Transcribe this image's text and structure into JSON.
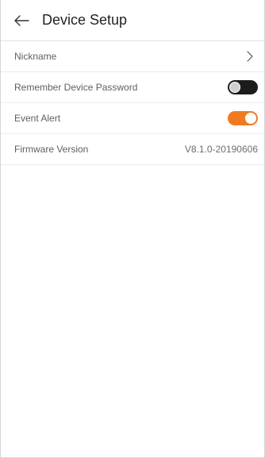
{
  "header": {
    "title": "Device Setup",
    "back_icon": "arrow-left-icon"
  },
  "settings": {
    "nickname": {
      "label": "Nickname",
      "icon": "chevron-right-icon"
    },
    "remember_password": {
      "label": "Remember Device Password",
      "enabled": false,
      "color": "#1c1c1c"
    },
    "event_alert": {
      "label": "Event Alert",
      "enabled": true,
      "color": "#f07a21"
    },
    "firmware": {
      "label": "Firmware Version",
      "value": "V8.1.0-20190606"
    }
  }
}
